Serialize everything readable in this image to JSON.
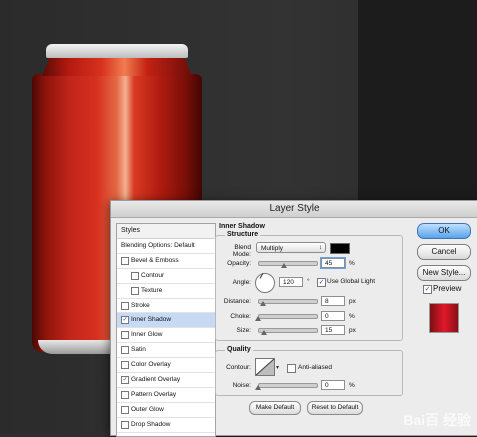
{
  "dialog": {
    "title": "Layer Style"
  },
  "styles": {
    "header": "Styles",
    "blending_options": "Blending Options: Default",
    "items": [
      {
        "label": "Bevel & Emboss",
        "checked": false,
        "sub": false
      },
      {
        "label": "Contour",
        "checked": false,
        "sub": true
      },
      {
        "label": "Texture",
        "checked": false,
        "sub": true
      },
      {
        "label": "Stroke",
        "checked": false,
        "sub": false
      },
      {
        "label": "Inner Shadow",
        "checked": true,
        "sub": false,
        "selected": true
      },
      {
        "label": "Inner Glow",
        "checked": false,
        "sub": false
      },
      {
        "label": "Satin",
        "checked": false,
        "sub": false
      },
      {
        "label": "Color Overlay",
        "checked": false,
        "sub": false
      },
      {
        "label": "Gradient Overlay",
        "checked": true,
        "sub": false
      },
      {
        "label": "Pattern Overlay",
        "checked": false,
        "sub": false
      },
      {
        "label": "Outer Glow",
        "checked": false,
        "sub": false
      },
      {
        "label": "Drop Shadow",
        "checked": false,
        "sub": false
      }
    ]
  },
  "inner_shadow": {
    "title": "Inner Shadow",
    "structure_title": "Structure",
    "blend_mode_label": "Blend Mode:",
    "blend_mode_value": "Multiply",
    "shadow_color": "#000000",
    "opacity_label": "Opacity:",
    "opacity_value": "45",
    "angle_label": "Angle:",
    "angle_value": "120",
    "angle_unit": "°",
    "use_global_light_label": "Use Global Light",
    "use_global_light": true,
    "distance_label": "Distance:",
    "distance_value": "8",
    "choke_label": "Choke:",
    "choke_value": "0",
    "size_label": "Size:",
    "size_value": "15",
    "unit_px": "px",
    "unit_pct": "%",
    "quality_title": "Quality",
    "contour_label": "Contour:",
    "anti_aliased_label": "Anti-aliased",
    "anti_aliased": false,
    "noise_label": "Noise:",
    "noise_value": "0",
    "make_default_label": "Make Default",
    "reset_default_label": "Reset to Default"
  },
  "buttons": {
    "ok": "OK",
    "cancel": "Cancel",
    "new_style": "New Style...",
    "preview_label": "Preview",
    "preview_checked": true
  },
  "slider_levels": {
    "opacity": 0.45,
    "distance": 0.08,
    "choke": 0.0,
    "size": 0.1,
    "noise": 0.0
  },
  "watermark": "Bai百 经验"
}
